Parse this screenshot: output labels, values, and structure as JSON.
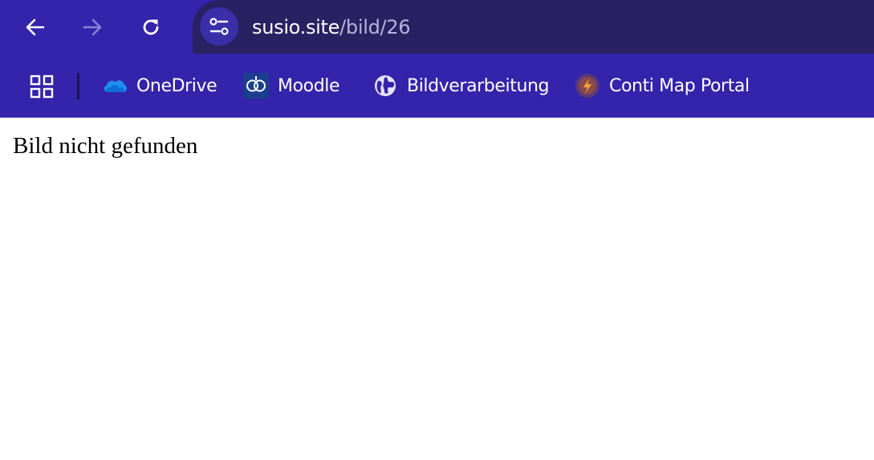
{
  "browser": {
    "nav": {
      "back_icon": "arrow-left-icon",
      "forward_icon": "arrow-right-icon",
      "reload_icon": "reload-icon"
    },
    "address_bar": {
      "site_info_icon": "tune-icon",
      "host": "susio.site",
      "path": "/bild/26"
    },
    "bookmarks": {
      "apps_icon": "apps-grid-icon",
      "items": [
        {
          "label": "OneDrive",
          "icon": "onedrive-icon"
        },
        {
          "label": "Moodle",
          "icon": "moodle-icon"
        },
        {
          "label": "Bildverarbeitung",
          "icon": "globe-icon"
        },
        {
          "label": "Conti Map Portal",
          "icon": "conti-map-icon"
        }
      ]
    },
    "colors": {
      "toolbar": "#3423ab",
      "omnibox": "#2a2163",
      "url_path": "#b9b3da"
    }
  },
  "page": {
    "message": "Bild nicht gefunden"
  }
}
